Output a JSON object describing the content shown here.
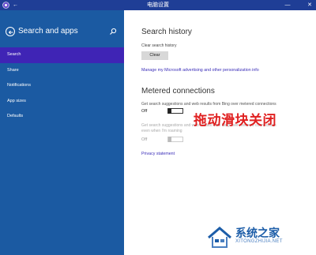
{
  "window": {
    "title": "电脑设置",
    "back_glyph": "←",
    "minimize_glyph": "—",
    "close_glyph": "✕"
  },
  "sidebar": {
    "title": "Search and apps",
    "items": [
      {
        "label": "Search",
        "active": true
      },
      {
        "label": "Share"
      },
      {
        "label": "Notifications"
      },
      {
        "label": "App sizes"
      },
      {
        "label": "Defaults"
      }
    ]
  },
  "main": {
    "search_history": {
      "heading": "Search history",
      "clear_label": "Clear search history",
      "clear_button": "Clear",
      "advertising_link": "Manage my Microsoft advertising and other personalization info"
    },
    "metered": {
      "heading": "Metered connections",
      "setting1_desc": "Get search suggestions and web results from Bing over metered connections",
      "setting1_state": "Off",
      "setting2_desc_line1": "Get search suggestions and web results from Bing over metered connections",
      "setting2_desc_line2": "even when I'm roaming",
      "setting2_state": "Off"
    },
    "privacy_link": "Privacy statement"
  },
  "annotation": "拖动滑块关闭",
  "watermark": {
    "name": "系统之家",
    "url": "XITONGZHIJIA.NET"
  },
  "colors": {
    "titlebar": "#1f3e96",
    "sidebar": "#1b5aa2",
    "active_item": "#3f24b5",
    "link": "#3a2db8",
    "annotation": "#e02020"
  }
}
